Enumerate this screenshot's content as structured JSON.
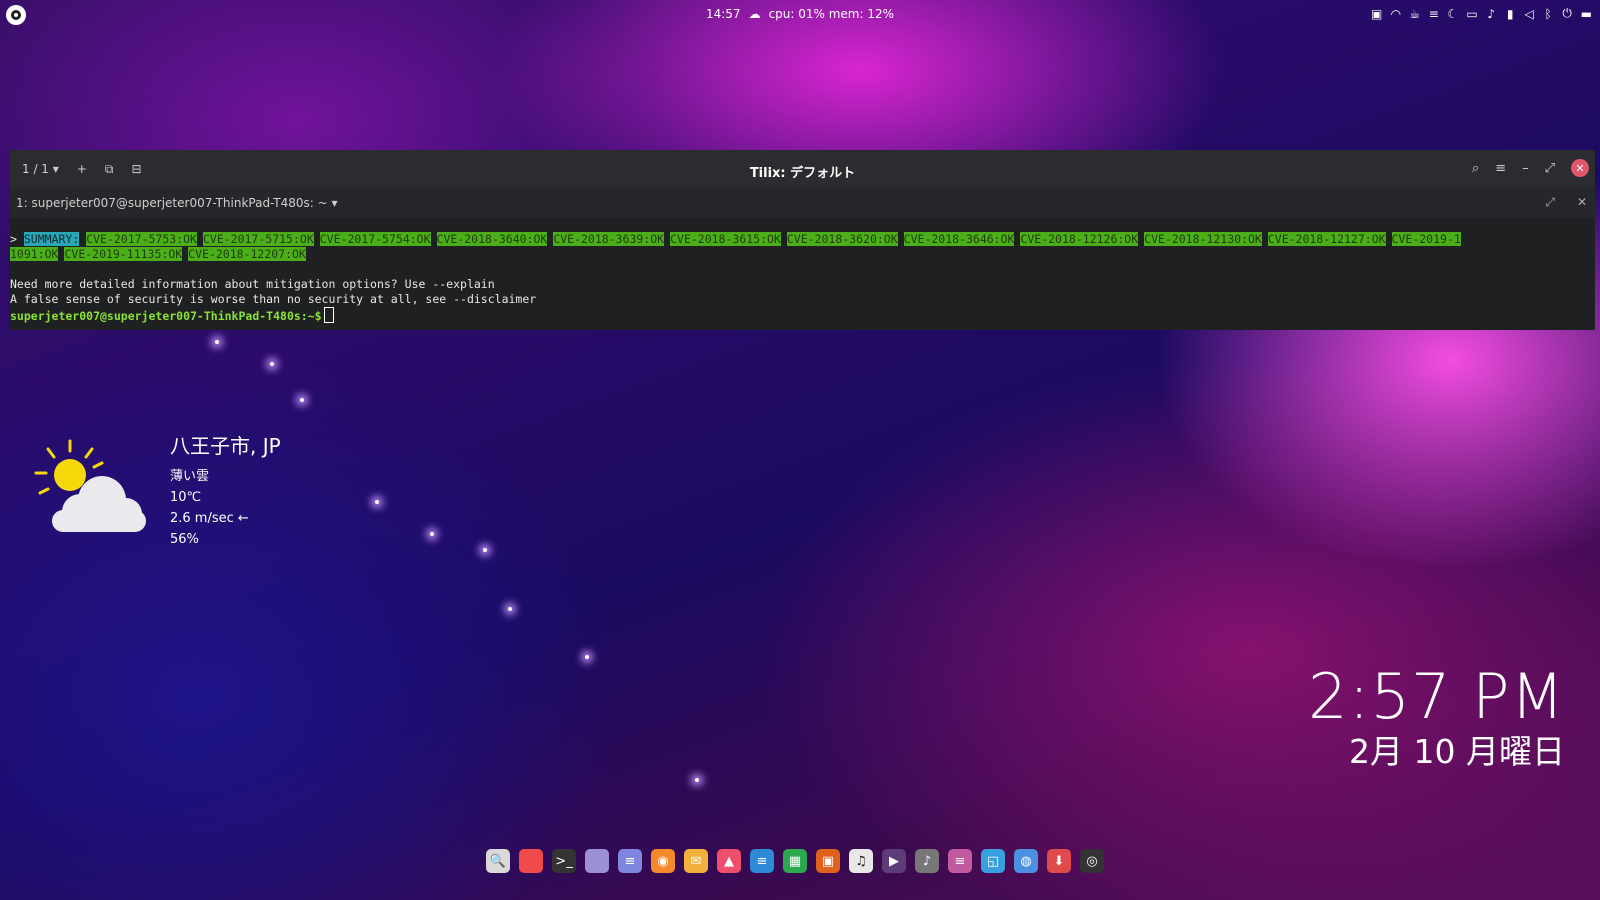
{
  "topbar": {
    "clock": "14:57",
    "weather_icon": "cloud-icon",
    "stats": "cpu: 01% mem: 12%",
    "tray_icons": [
      "app-icon",
      "wifi-icon",
      "coffee-icon",
      "list-icon",
      "moon-icon",
      "calendar-icon",
      "bell-icon",
      "battery-icon",
      "volume-icon",
      "bluetooth-icon",
      "power-icon",
      "window-icon"
    ]
  },
  "terminal": {
    "tab_counter": "1 / 1",
    "title": "Tilix: デフォルト",
    "session_label": "1: superjeter007@superjeter007-ThinkPad-T480s: ~",
    "line1_prefix": "> ",
    "summary_label": "SUMMARY:",
    "cves_line1": [
      "CVE-2017-5753:OK",
      "CVE-2017-5715:OK",
      "CVE-2017-5754:OK",
      "CVE-2018-3640:OK",
      "CVE-2018-3639:OK",
      "CVE-2018-3615:OK",
      "CVE-2018-3620:OK",
      "CVE-2018-3646:OK",
      "CVE-2018-12126:OK",
      "CVE-2018-12130:OK",
      "CVE-2018-12127:OK",
      "CVE-2019-1"
    ],
    "cves_line2": [
      "1091:OK",
      "CVE-2019-11135:OK",
      "CVE-2018-12207:OK"
    ],
    "msg1": "Need more detailed information about mitigation options? Use --explain",
    "msg2": "A false sense of security is worse than no security at all, see --disclaimer",
    "prompt": "superjeter007@superjeter007-ThinkPad-T480s:~$"
  },
  "weather": {
    "city": "八王子市, JP",
    "condition": "薄い雲",
    "temperature": "10℃",
    "wind": "2.6 m/sec ←",
    "humidity": "56%"
  },
  "clock": {
    "time": "2:57 PM",
    "date": "2月 10 月曜日"
  },
  "dock": {
    "apps": [
      {
        "name": "search-app-icon",
        "color": "#d9d9d9",
        "glyph": "🔍"
      },
      {
        "name": "calendar-app-icon",
        "color": "#f04a4a",
        "glyph": ""
      },
      {
        "name": "terminal-app-icon",
        "color": "#333333",
        "glyph": ">_"
      },
      {
        "name": "files-app-icon",
        "color": "#9c8fd6",
        "glyph": ""
      },
      {
        "name": "text-editor-app-icon",
        "color": "#7f86e0",
        "glyph": "≡"
      },
      {
        "name": "firefox-app-icon",
        "color": "#f3892b",
        "glyph": "◉"
      },
      {
        "name": "mail-app-icon",
        "color": "#f2b13c",
        "glyph": "✉"
      },
      {
        "name": "photos-app-icon",
        "color": "#ef4f6a",
        "glyph": "▲"
      },
      {
        "name": "writer-app-icon",
        "color": "#2c8ad6",
        "glyph": "≡"
      },
      {
        "name": "calc-app-icon",
        "color": "#2ea84f",
        "glyph": "▦"
      },
      {
        "name": "impress-app-icon",
        "color": "#e0601d",
        "glyph": "▣"
      },
      {
        "name": "music-app-icon",
        "color": "#e8e8e8",
        "glyph": "♫"
      },
      {
        "name": "video-app-icon",
        "color": "#5c3c7a",
        "glyph": "▶"
      },
      {
        "name": "audio-editor-app-icon",
        "color": "#777777",
        "glyph": "♪"
      },
      {
        "name": "settings-app-icon",
        "color": "#c25aa0",
        "glyph": "≡"
      },
      {
        "name": "window-manager-app-icon",
        "color": "#39a0e0",
        "glyph": "◱"
      },
      {
        "name": "browser-app-icon",
        "color": "#4a8fe0",
        "glyph": "◍"
      },
      {
        "name": "software-center-app-icon",
        "color": "#e04a4a",
        "glyph": "⬇"
      },
      {
        "name": "system-app-icon",
        "color": "#333333",
        "glyph": "◎"
      }
    ]
  }
}
